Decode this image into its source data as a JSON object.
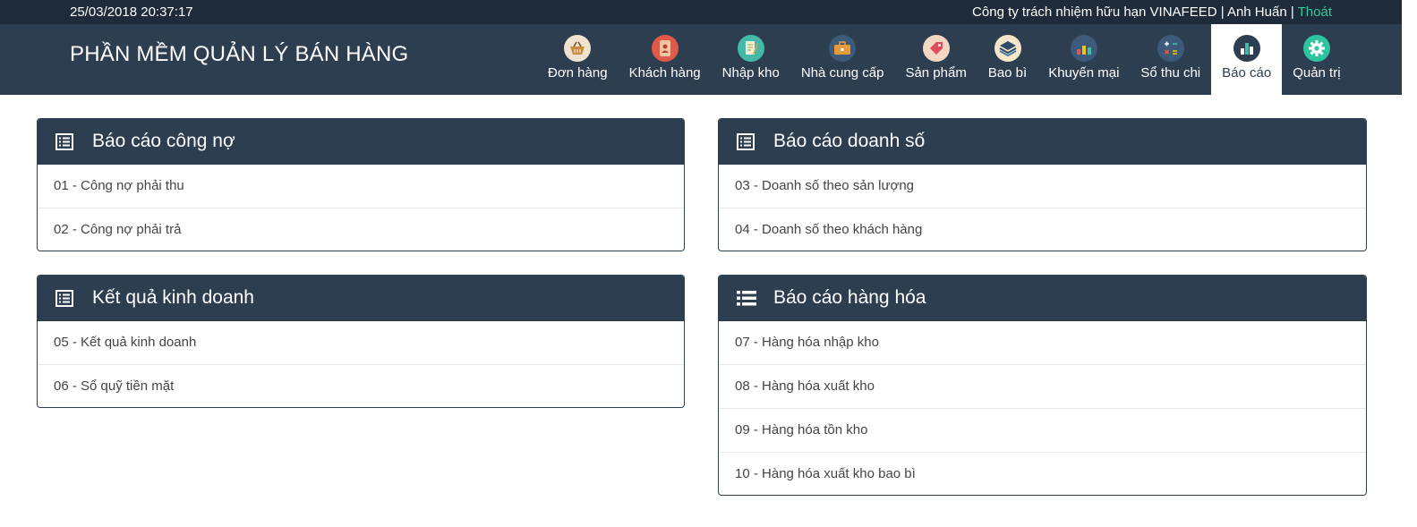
{
  "topbar": {
    "datetime": "25/03/2018 20:37:17",
    "company_user": "Công ty trách nhiệm hữu hạn VINAFEED | Anh Huấn | ",
    "logout": "Thoát",
    "logout_color": "#2ecc9a"
  },
  "header": {
    "app_title": "PHẦN MỀM QUẢN LÝ BÁN HÀNG"
  },
  "nav": {
    "items": [
      {
        "label": "Đơn hàng",
        "icon": "basket-icon"
      },
      {
        "label": "Khách hàng",
        "icon": "address-book-icon"
      },
      {
        "label": "Nhập kho",
        "icon": "receipt-pen-icon"
      },
      {
        "label": "Nhà cung cấp",
        "icon": "briefcase-icon"
      },
      {
        "label": "Sản phẩm",
        "icon": "price-tag-icon"
      },
      {
        "label": "Bao bì",
        "icon": "layers-icon"
      },
      {
        "label": "Khuyến mại",
        "icon": "coin-stack-icon"
      },
      {
        "label": "Sổ thu chi",
        "icon": "calculator-icon"
      },
      {
        "label": "Báo cáo",
        "icon": "bar-chart-icon",
        "active": true
      },
      {
        "label": "Quản trị",
        "icon": "gear-icon"
      }
    ]
  },
  "panels": {
    "debt": {
      "title": "Báo cáo công nợ",
      "items": [
        "01 - Công nợ phải thu",
        "02 - Công nợ phải trả"
      ]
    },
    "revenue": {
      "title": "Báo cáo doanh số",
      "items": [
        "03 - Doanh số theo sản lượng",
        "04 - Doanh số theo khách hàng"
      ]
    },
    "business": {
      "title": "Kết quả kinh doanh",
      "items": [
        "05 - Kết quả kinh doanh",
        "06 - Sổ quỹ tiền mặt"
      ]
    },
    "goods": {
      "title": "Báo cáo hàng hóa",
      "items": [
        "07 - Hàng hóa nhập kho",
        "08 - Hàng hóa xuất kho",
        "09 - Hàng hóa tồn kho",
        "10 - Hàng hóa xuất kho bao bì"
      ]
    }
  },
  "colors": {
    "header_bg": "#2c3e50",
    "topbar_bg": "#1d2b3a",
    "panel_border": "#2c3e50"
  }
}
